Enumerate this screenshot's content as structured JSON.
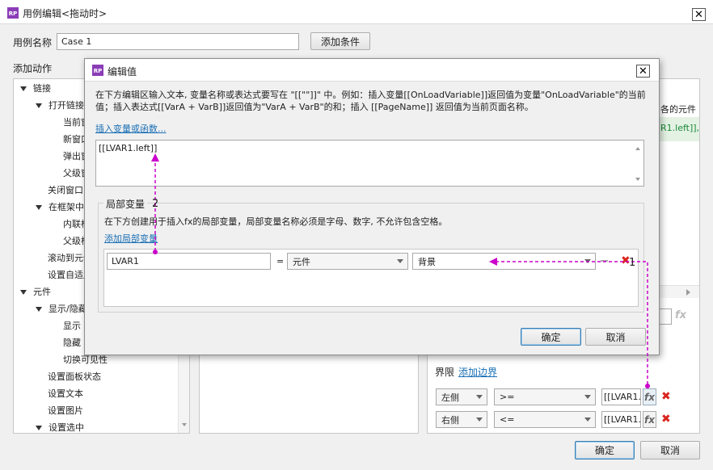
{
  "main_window": {
    "title": "用例编辑<拖动时>",
    "logo": "RP",
    "case_name_label": "用例名称",
    "case_name_value": "Case 1",
    "add_condition_label": "添加条件",
    "add_action_label": "添加动作",
    "ok_label": "确定",
    "cancel_label": "取消"
  },
  "action_tree": [
    {
      "label": "链接",
      "level": 0,
      "expanded": true
    },
    {
      "label": "打开链接",
      "level": 1,
      "expanded": true
    },
    {
      "label": "当前窗口",
      "level": 2
    },
    {
      "label": "新窗口/新标签",
      "level": 2
    },
    {
      "label": "弹出窗口",
      "level": 2
    },
    {
      "label": "父级窗口",
      "level": 2
    },
    {
      "label": "关闭窗口",
      "level": 1
    },
    {
      "label": "在框架中打开链接",
      "level": 1,
      "expanded": true
    },
    {
      "label": "内联框架",
      "level": 2
    },
    {
      "label": "父级框架",
      "level": 2
    },
    {
      "label": "滚动到元件<锚链接>",
      "level": 1
    },
    {
      "label": "设置自适应视图",
      "level": 1
    },
    {
      "label": "元件",
      "level": 0,
      "expanded": true
    },
    {
      "label": "显示/隐藏",
      "level": 1,
      "expanded": true
    },
    {
      "label": "显示",
      "level": 2
    },
    {
      "label": "隐藏",
      "level": 2
    },
    {
      "label": "切换可见性",
      "level": 2
    },
    {
      "label": "设置面板状态",
      "level": 1
    },
    {
      "label": "设置文本",
      "level": 1
    },
    {
      "label": "设置图片",
      "level": 1
    },
    {
      "label": "设置选中",
      "level": 1,
      "expanded": true
    }
  ],
  "right_panel": {
    "header_partial": "各的元件",
    "green_row_partial": "R1.left]], ι",
    "bounds_label": "界限",
    "add_bounds_label": "添加边界",
    "bounds": [
      {
        "side": "左侧",
        "operator": ">=",
        "value": "[[LVAR1."
      },
      {
        "side": "右侧",
        "operator": "<=",
        "value": "[[LVAR1."
      }
    ],
    "fx_label": "fx"
  },
  "edit_dialog": {
    "title": "编辑值",
    "logo": "RP",
    "description": "在下方编辑区输入文本, 变量名称或表达式要写在 \"[[\"\"]]\" 中。例如：插入变量[[OnLoadVariable]]返回值为变量\"OnLoadVariable\"的当前值；插入表达式[[VarA + VarB]]返回值为\"VarA + VarB\"的和；插入 [[PageName]] 返回值为当前页面名称。",
    "insert_link": "插入变量或函数...",
    "editor_value": "[[LVAR1.left]]",
    "local_vars_title": "局部变量",
    "local_vars_desc": "在下方创建用于插入fx的局部变量，局部变量名称必须是字母、数字, 不允许包含空格。",
    "add_local_var_link": "添加局部变量",
    "local_var": {
      "name": "LVAR1",
      "equals": "=",
      "type": "元件",
      "target": "背景"
    },
    "ok_label": "确定",
    "cancel_label": "取消"
  },
  "annotations": {
    "label_1": "1",
    "label_2": "2",
    "arrow_color": "#cc00cc"
  }
}
